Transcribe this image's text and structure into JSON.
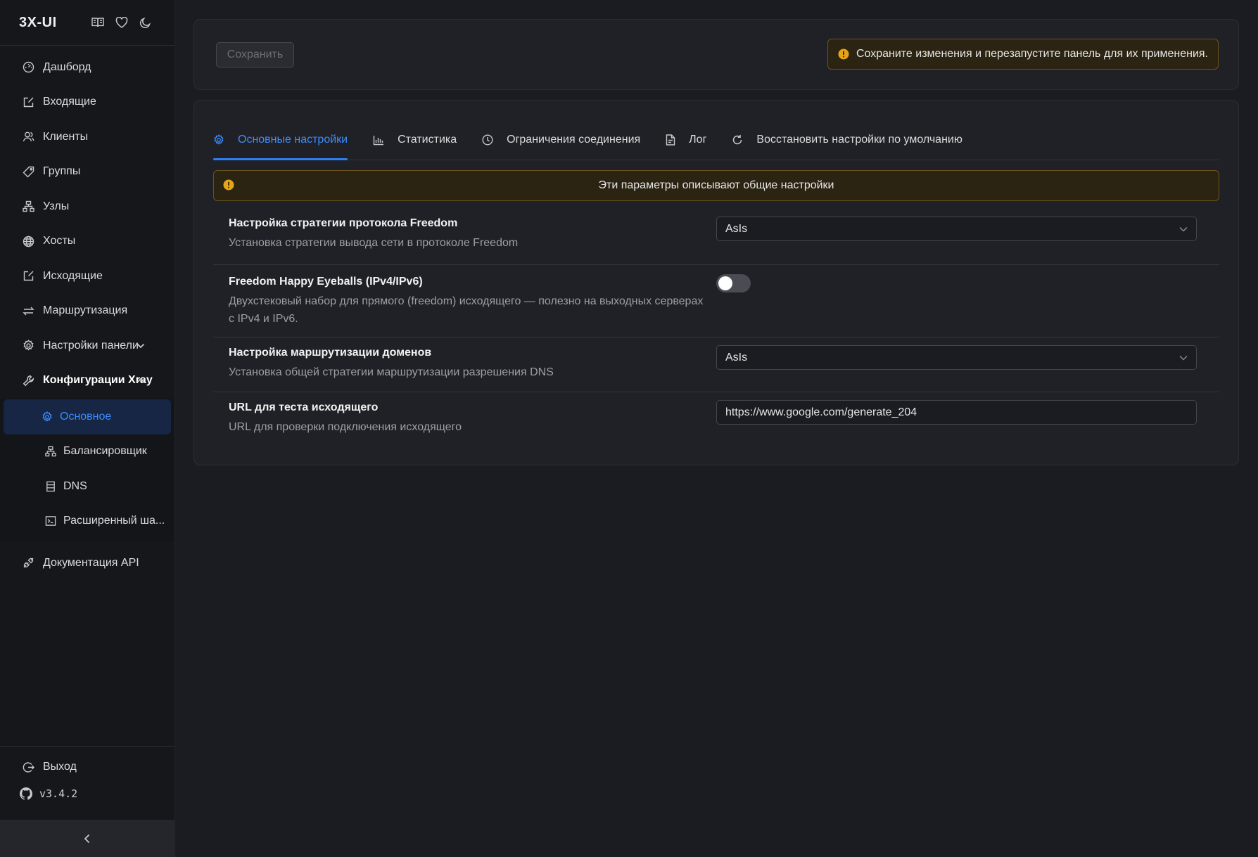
{
  "brand": {
    "title": "3X-UI",
    "icons": [
      "book-icon",
      "heart-icon",
      "moon-icon"
    ]
  },
  "sidebar": {
    "items": [
      {
        "label": "Дашборд",
        "icon": "dashboard-icon"
      },
      {
        "label": "Входящие",
        "icon": "edit-box-icon"
      },
      {
        "label": "Клиенты",
        "icon": "users-icon"
      },
      {
        "label": "Группы",
        "icon": "tag-icon"
      },
      {
        "label": "Узлы",
        "icon": "nodes-icon"
      },
      {
        "label": "Хосты",
        "icon": "globe-icon"
      },
      {
        "label": "Исходящие",
        "icon": "edit-box-icon"
      },
      {
        "label": "Маршрутизация",
        "icon": "swap-icon"
      },
      {
        "label": "Настройки панели",
        "icon": "gear-icon"
      },
      {
        "label": "Конфигурации Xray",
        "icon": "wrench-icon"
      }
    ],
    "submenu": [
      {
        "label": "Основное",
        "icon": "gear-icon",
        "active": true
      },
      {
        "label": "Балансировщик",
        "icon": "cluster-icon"
      },
      {
        "label": "DNS",
        "icon": "database-icon"
      },
      {
        "label": "Расширенный ша...",
        "icon": "code-icon"
      }
    ],
    "api_docs": {
      "label": "Документация API",
      "icon": "api-icon"
    },
    "logout": {
      "label": "Выход",
      "icon": "logout-icon"
    },
    "version": "v3.4.2"
  },
  "toolbar": {
    "save_label": "Сохранить",
    "warning": "Сохраните изменения и перезапустите панель для их применения."
  },
  "tabs": [
    {
      "label": "Основные настройки",
      "icon": "gear-icon",
      "active": true
    },
    {
      "label": "Статистика",
      "icon": "bar-chart-icon"
    },
    {
      "label": "Ограничения соединения",
      "icon": "clock-icon"
    },
    {
      "label": "Лог",
      "icon": "file-icon"
    },
    {
      "label": "Восстановить настройки по умолчанию",
      "icon": "reload-icon"
    }
  ],
  "info_banner": "Эти параметры описывают общие настройки",
  "settings": {
    "freedom_strategy": {
      "title": "Настройка стратегии протокола Freedom",
      "desc": "Установка стратегии вывода сети в протоколе Freedom",
      "value": "AsIs"
    },
    "happy_eyeballs": {
      "title": "Freedom Happy Eyeballs (IPv4/IPv6)",
      "desc": "Двухстековый набор для прямого (freedom) исходящего — полезно на выходных серверах с IPv4 и IPv6.",
      "enabled": false
    },
    "domain_routing": {
      "title": "Настройка маршрутизации доменов",
      "desc": "Установка общей стратегии маршрутизации разрешения DNS",
      "value": "AsIs"
    },
    "outbound_test_url": {
      "title": "URL для теста исходящего",
      "desc": "URL для проверки подключения исходящего",
      "value": "https://www.google.com/generate_204"
    }
  },
  "colors": {
    "accent": "#3c8cff",
    "warning_bg": "#2b2413",
    "warning_border": "#6b541a",
    "warning_icon": "#e8a317"
  }
}
